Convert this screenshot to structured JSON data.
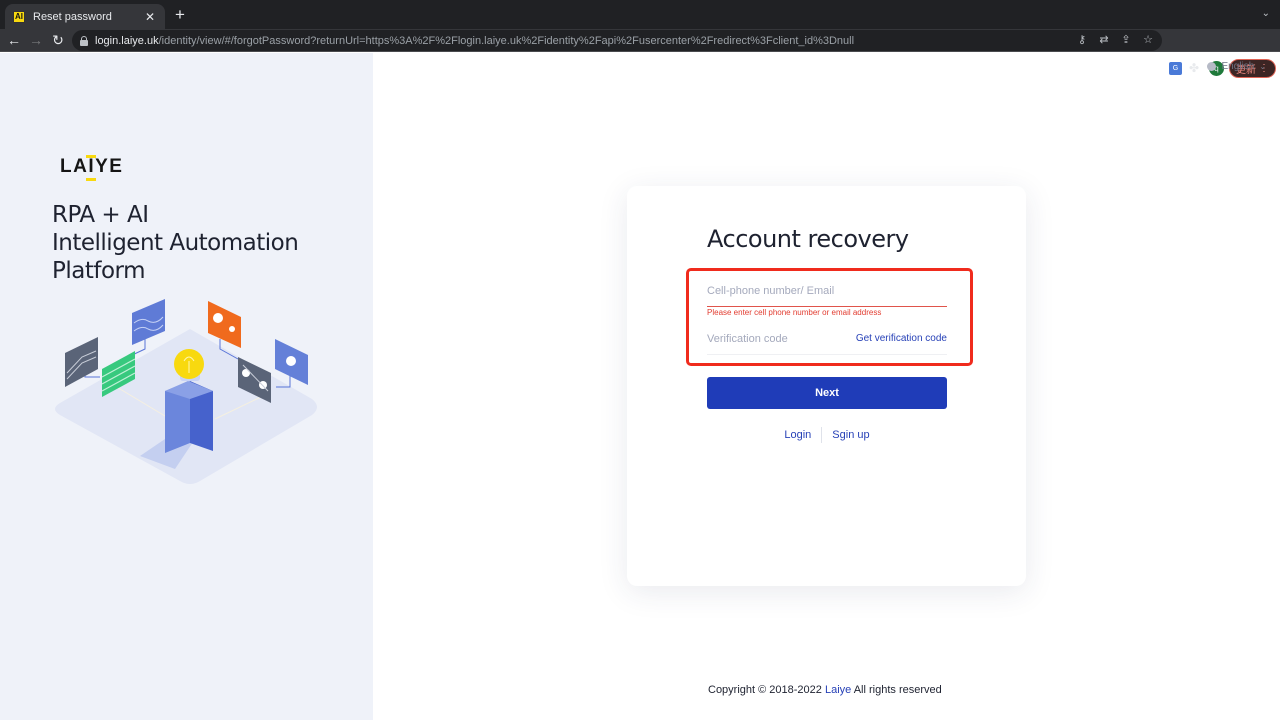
{
  "browser": {
    "tab": {
      "title": "Reset password",
      "favicon": "AI"
    },
    "new_tab_label": "+",
    "url_host": "login.laiye.uk",
    "url_path": "/identity/view/#/forgotPassword?returnUrl=https%3A%2F%2Flogin.laiye.uk%2Fidentity%2Fapi%2Fusercenter%2Fredirect%3Fclient_id%3Dnull",
    "profile_initial": "q",
    "update_label": "更新",
    "icons": {
      "back": "←",
      "forward": "→",
      "reload": "↻",
      "close": "✕",
      "key": "⚷",
      "translate": "⇄",
      "share": "⇪",
      "star": "☆",
      "translate_ext": "G",
      "puzzle": "✤",
      "menu": "⋮",
      "chevron": "⌄"
    }
  },
  "language": {
    "selected": "English",
    "chevron": "⌄"
  },
  "brand": {
    "logo_parts": [
      "LA",
      "I",
      "YE"
    ],
    "tagline": [
      "RPA + AI",
      "Intelligent Automation",
      "Platform"
    ],
    "colors": {
      "yellow": "#f8d90f",
      "panel_bg": "#eff2f9"
    }
  },
  "form": {
    "title": "Account recovery",
    "account_field": {
      "value": "",
      "placeholder": "Cell-phone number/ Email"
    },
    "account_error": "Please enter cell phone number or email address",
    "code_field": {
      "value": "",
      "placeholder": "Verification code"
    },
    "get_code_label": "Get verification code",
    "next_label": "Next",
    "login_label": "Login",
    "signup_label": "Sgin up",
    "colors": {
      "primary": "#1f3cb8",
      "error": "#e23c30",
      "highlight": "#f02b1d"
    }
  },
  "footer": {
    "prefix": "Copyright © 2018-2022 ",
    "link": "Laiye",
    "suffix": " All rights reserved"
  }
}
